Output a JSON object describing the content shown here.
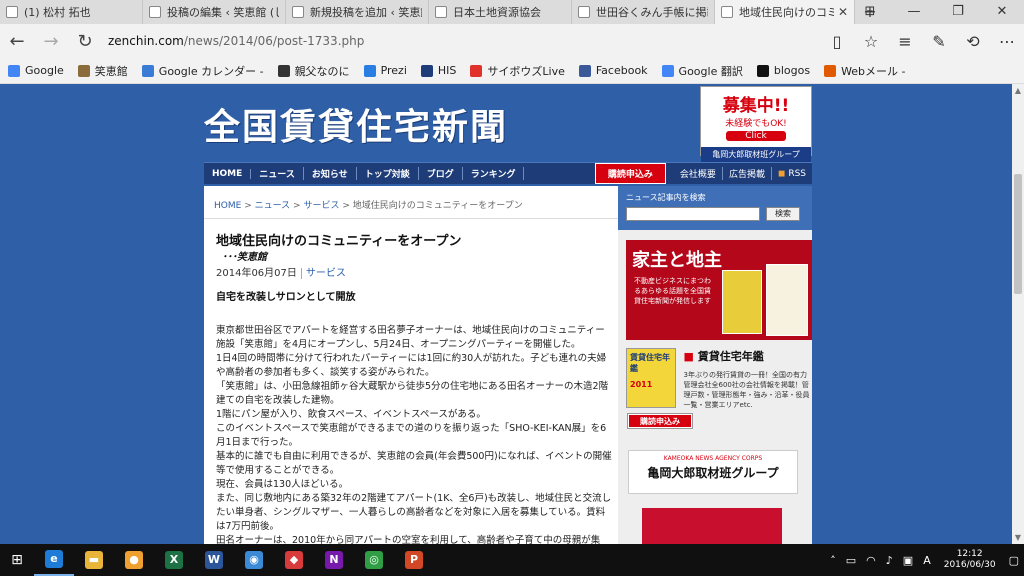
{
  "browser": {
    "tabs": [
      {
        "label": "(1) 松村 拓也",
        "active": false
      },
      {
        "label": "投稿の編集 ‹ 笑恵館 (しよ",
        "active": false
      },
      {
        "label": "新規投稿を追加 ‹ 笑恵館",
        "active": false
      },
      {
        "label": "日本土地資源協会",
        "active": false
      },
      {
        "label": "世田谷くみん手帳に掲載され",
        "active": false
      },
      {
        "label": "地域住民向けのコミュニテ",
        "active": true
      }
    ],
    "new_tab": "+",
    "url_host": "zenchin.com",
    "url_path": "/news/2014/06/post-1733.php",
    "favorites": [
      {
        "label": "Google",
        "color": "#4285f4"
      },
      {
        "label": "笑恵館",
        "color": "#8a6d3b"
      },
      {
        "label": "Google カレンダー -",
        "color": "#3a7bd5"
      },
      {
        "label": "親父なのに",
        "color": "#333333"
      },
      {
        "label": "Prezi",
        "color": "#2a7de1"
      },
      {
        "label": "HIS",
        "color": "#1d3c78"
      },
      {
        "label": "サイボウズLive",
        "color": "#e0312b"
      },
      {
        "label": "Facebook",
        "color": "#3b5998"
      },
      {
        "label": "Google 翻訳",
        "color": "#4285f4"
      },
      {
        "label": "blogos",
        "color": "#111111"
      },
      {
        "label": "Webメール -",
        "color": "#e05b00"
      }
    ]
  },
  "site": {
    "logo": "全国賃貸住宅新聞",
    "recruit": {
      "headline": "募集中!!",
      "sub": "未経験でもOK!",
      "click": "Click",
      "group": "亀岡大郎取材班グループ"
    },
    "nav": [
      "HOME",
      "ニュース",
      "お知らせ",
      "トップ対談",
      "ブログ",
      "ランキング"
    ],
    "subscribe": "購読申込み",
    "nav_right": [
      "会社概要",
      "広告掲載",
      "RSS"
    ]
  },
  "article": {
    "breadcrumb": {
      "home": "HOME",
      "news": "ニュース",
      "service": "サービス",
      "current": "地域住民向けのコミュニティーをオープン",
      "sep": ">"
    },
    "title": "地域住民向けのコミュニティーをオープン",
    "subtitle": "･･･笑恵館",
    "date": "2014年06月07日",
    "category": "サービス",
    "lead": "自宅を改装しサロンとして開放",
    "paragraphs": [
      "東京都世田谷区でアパートを経営する田名夢子オーナーは、地域住民向けのコミュニティー施設「笑恵館」を4月にオープンし、5月24日、オープニングパーティーを開催した。",
      "1日4回の時間帯に分けて行われたパーティーには1回に約30人が訪れた。子ども連れの夫婦や高齢者の参加者も多く、談笑する姿がみられた。",
      "「笑恵館」は、小田急線祖師ヶ谷大蔵駅から徒歩5分の住宅地にある田名オーナーの木造2階建ての自宅を改装した建物。",
      "1階にパン屋が入り、飲食スペース、イベントスペースがある。",
      "このイベントスペースで笑恵館ができるまでの道のりを振り返った「SHO-KEI-KAN展」を6月1日まで行った。",
      "基本的に誰でも自由に利用できるが、笑恵館の会員(年会費500円)になれば、イベントの開催等で使用することができる。",
      "現在、会員は130人ほどいる。",
      "また、同じ敷地内にある築32年の2階建てアパート(1K、全6戸)も改装し、地域住民と交流したい単身者、シングルマザー、一人暮らしの高齢者などを対象に入居を募集している。賃料は7万円前後。",
      "田名オーナーは、2010年から同アパートの空室を利用して、高齢者や子育て中の母親が集"
    ]
  },
  "sidebar": {
    "search_label": "ニュース記事内を検索",
    "search_button": "検索",
    "ad_title": "家主と地主",
    "ad_copy": "不動産ビジネスにまつわるあらゆる話題を全国賃貸住宅新聞が発信します",
    "yearbook_cover": "賃貸住宅年鑑",
    "yearbook_year": "2011",
    "yearbook_title": "賃貸住宅年鑑",
    "yearbook_desc": "3年ぶりの発行賃貸の一冊！全国の有力管理会社全600社の会社情報を掲載！管理戸数・管理形態年・強み・沿革・役員一覧・営業エリアetc.",
    "yearbook_button": "購読申込み",
    "kameoka_small": "KAMEOKA NEWS AGENCY CORPS",
    "kameoka_name": "亀岡大郎取材班グループ"
  },
  "taskbar": {
    "apps": [
      {
        "name": "edge",
        "glyph": "e",
        "color": "#1e7bd6",
        "active": true
      },
      {
        "name": "explorer",
        "glyph": "▬",
        "color": "#e8b53a",
        "active": false
      },
      {
        "name": "app-orange",
        "glyph": "●",
        "color": "#f0a030",
        "active": false
      },
      {
        "name": "excel",
        "glyph": "X",
        "color": "#1e7145",
        "active": false
      },
      {
        "name": "word",
        "glyph": "W",
        "color": "#2b579a",
        "active": false
      },
      {
        "name": "app-blue",
        "glyph": "◉",
        "color": "#3a8ad6",
        "active": false
      },
      {
        "name": "app-red",
        "glyph": "◆",
        "color": "#d83b3b",
        "active": false
      },
      {
        "name": "onenote",
        "glyph": "N",
        "color": "#7719aa",
        "active": false
      },
      {
        "name": "chrome",
        "glyph": "◎",
        "color": "#2f9e44",
        "active": false
      },
      {
        "name": "powerpoint",
        "glyph": "P",
        "color": "#d24726",
        "active": false
      }
    ],
    "ime": "A",
    "time": "12:12",
    "date": "2016/06/30"
  }
}
